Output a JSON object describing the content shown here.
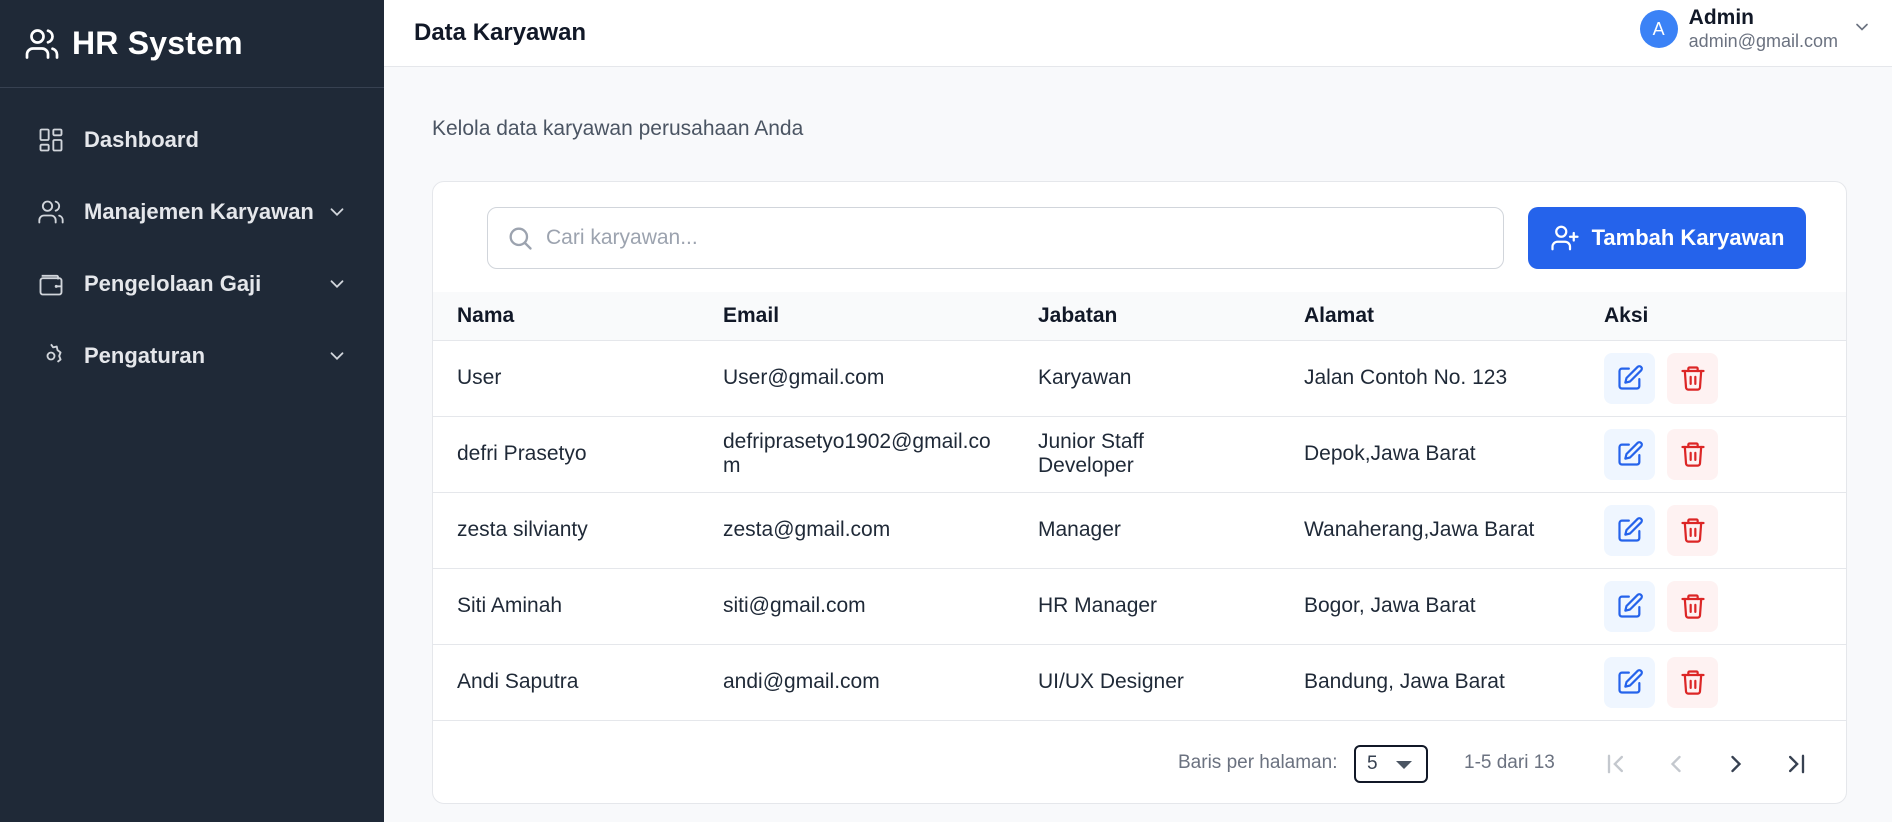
{
  "app": {
    "title": "HR System"
  },
  "sidebar": {
    "items": [
      {
        "label": "Dashboard",
        "icon": "dashboard-icon",
        "expandable": false
      },
      {
        "label": "Manajemen Karyawan",
        "icon": "users-icon",
        "expandable": true
      },
      {
        "label": "Pengelolaan Gaji",
        "icon": "wallet-icon",
        "expandable": true
      },
      {
        "label": "Pengaturan",
        "icon": "gear-icon",
        "expandable": true
      }
    ]
  },
  "header": {
    "title": "Data Karyawan",
    "user": {
      "initial": "A",
      "name": "Admin",
      "email": "admin@gmail.com"
    }
  },
  "main": {
    "subtitle": "Kelola data karyawan perusahaan Anda",
    "search_placeholder": "Cari karyawan...",
    "add_button": "Tambah Karyawan",
    "table": {
      "columns": [
        "Nama",
        "Email",
        "Jabatan",
        "Alamat",
        "Aksi"
      ],
      "rows": [
        {
          "nama": "User",
          "email": "User@gmail.com",
          "jabatan": "Karyawan",
          "alamat": "Jalan Contoh No. 123"
        },
        {
          "nama": "defri Prasetyo",
          "email": "defriprasetyo1902@gmail.com",
          "jabatan": "Junior Staff Developer",
          "alamat": "Depok,Jawa Barat"
        },
        {
          "nama": "zesta silvianty",
          "email": "zesta@gmail.com",
          "jabatan": "Manager",
          "alamat": "Wanaherang,Jawa Barat"
        },
        {
          "nama": "Siti Aminah",
          "email": "siti@gmail.com",
          "jabatan": "HR Manager",
          "alamat": "Bogor, Jawa Barat"
        },
        {
          "nama": "Andi Saputra",
          "email": "andi@gmail.com",
          "jabatan": "UI/UX Designer",
          "alamat": "Bandung, Jawa Barat"
        }
      ]
    },
    "pagination": {
      "rows_label": "Baris per halaman:",
      "rows_value": "5",
      "range": "1-5 dari 13"
    }
  },
  "colors": {
    "sidebar_bg": "#1f2937",
    "primary": "#2563eb",
    "edit": "#2563eb",
    "delete": "#dc2626"
  }
}
